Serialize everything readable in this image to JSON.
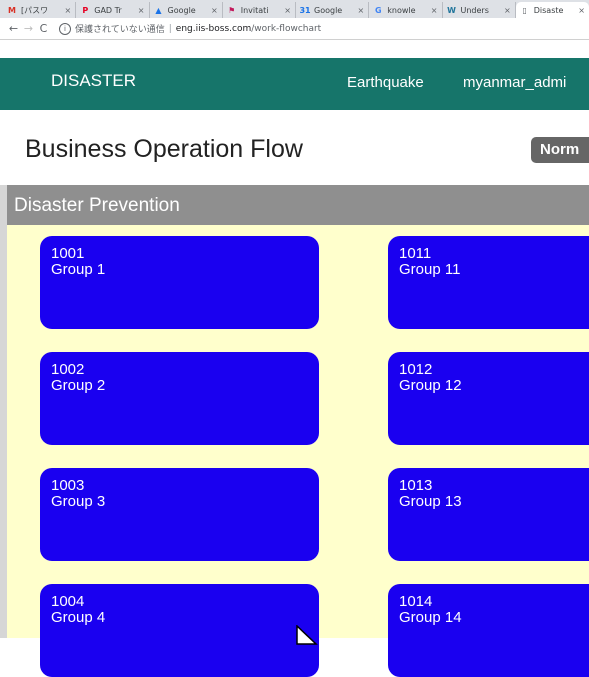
{
  "browser": {
    "tabs": [
      {
        "label": "[パスワ",
        "icon": "gmail-icon",
        "glyph": "M",
        "color": "#d93025",
        "active": false
      },
      {
        "label": "GAD Tr",
        "icon": "pinterest-icon",
        "glyph": "P",
        "color": "#e60023",
        "active": false
      },
      {
        "label": "Google",
        "icon": "google-drive-icon",
        "glyph": "▲",
        "color": "#1a73e8",
        "active": false
      },
      {
        "label": "Invitati",
        "icon": "bookmark-icon",
        "glyph": "⚑",
        "color": "#c2185b",
        "active": false
      },
      {
        "label": "Google",
        "icon": "google-calendar-icon",
        "glyph": "31",
        "color": "#1a73e8",
        "active": false
      },
      {
        "label": "knowle",
        "icon": "google-search-icon",
        "glyph": "G",
        "color": "#4285f4",
        "active": false
      },
      {
        "label": "Unders",
        "icon": "wordpress-icon",
        "glyph": "W",
        "color": "#21759b",
        "active": false
      },
      {
        "label": "Disaste",
        "icon": "page-icon",
        "glyph": "▯",
        "color": "#5f6368",
        "active": true
      }
    ],
    "close_glyph": "×",
    "address": {
      "back": "←",
      "forward": "→",
      "reload": "C",
      "info": "i",
      "secure_text": "保護されていない通信",
      "separator": "|",
      "host": "eng.iis-boss.com",
      "path": "/work-flowchart"
    }
  },
  "header": {
    "brand": "DISASTER",
    "nav_earthquake": "Earthquake",
    "nav_user": "myanmar_admi"
  },
  "page": {
    "title": "Business Operation Flow",
    "status_badge": "Norm"
  },
  "section": {
    "title": "Disaster Prevention",
    "colors": {
      "header": "#8f8f8f",
      "body": "#ffffcc",
      "card": "#1a00f0"
    },
    "cards": [
      {
        "code": "1001",
        "name": "Group 1"
      },
      {
        "code": "1002",
        "name": "Group 2"
      },
      {
        "code": "1003",
        "name": "Group 3"
      },
      {
        "code": "1004",
        "name": "Group 4"
      },
      {
        "code": "1011",
        "name": "Group 11"
      },
      {
        "code": "1012",
        "name": "Group 12"
      },
      {
        "code": "1013",
        "name": "Group 13"
      },
      {
        "code": "1014",
        "name": "Group 14"
      }
    ]
  }
}
